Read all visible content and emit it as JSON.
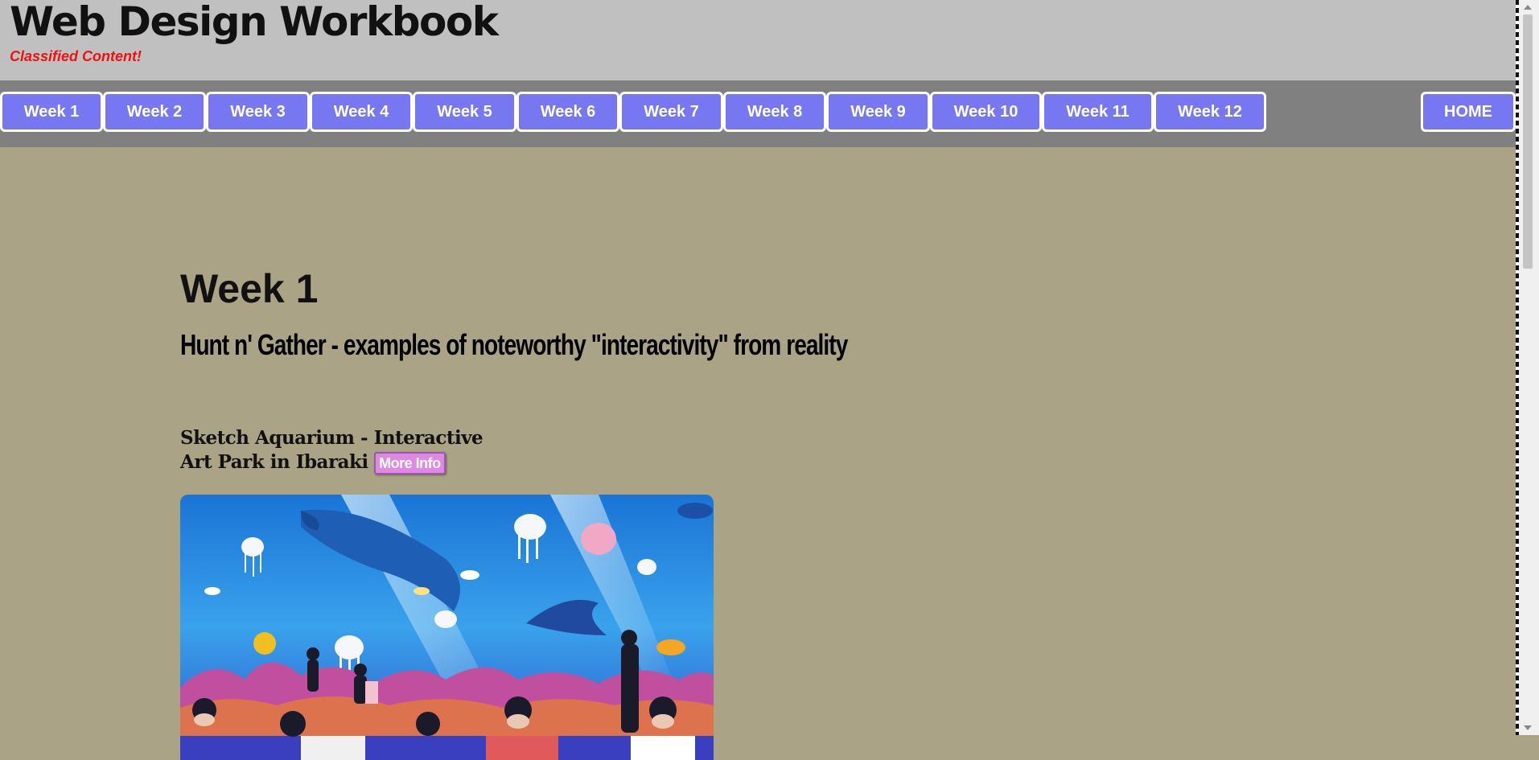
{
  "header": {
    "title": "Web Design Workbook",
    "tagline": "Classified Content!"
  },
  "nav": {
    "weeks": [
      "Week 1",
      "Week 2",
      "Week 3",
      "Week 4",
      "Week 5",
      "Week 6",
      "Week 7",
      "Week 8",
      "Week 9",
      "Week 10",
      "Week 11",
      "Week 12"
    ],
    "home": "HOME"
  },
  "main": {
    "heading": "Week 1",
    "subheading": "Hunt n' Gather - examples of noteworthy \"interactivity\" from reality",
    "item": {
      "title": "Sketch Aquarium - Interactive Art Park in Ibaraki",
      "button": "More Info"
    }
  },
  "colors": {
    "page_bg": "#aaa386",
    "header_bg": "#c0c0c0",
    "nav_bg": "#808080",
    "nav_button": "#7777f2",
    "tagline": "#ee1111",
    "more_info": "#e088e6"
  }
}
